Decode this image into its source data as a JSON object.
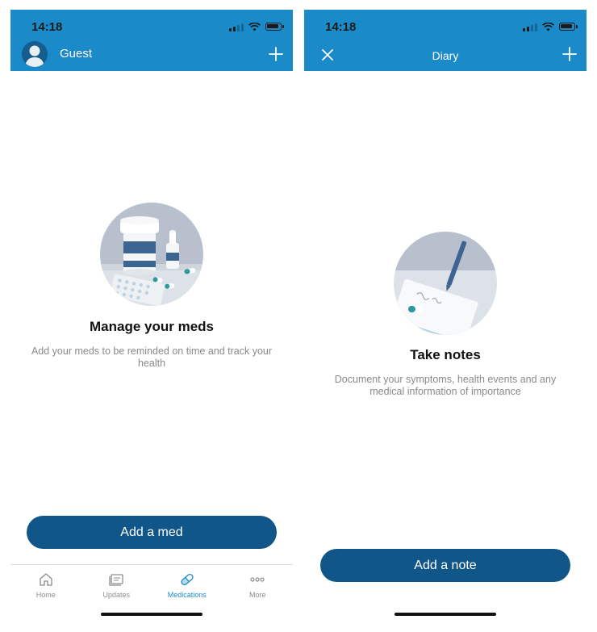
{
  "left_screen": {
    "status_time": "14:18",
    "header": {
      "user_name": "Guest"
    },
    "empty_state": {
      "title": "Manage your meds",
      "description": "Add your meds to be reminded on time and track your health"
    },
    "primary_button": "Add a med",
    "tabs": [
      {
        "label": "Home",
        "icon": "home-icon"
      },
      {
        "label": "Updates",
        "icon": "updates-icon"
      },
      {
        "label": "Medications",
        "icon": "pill-icon",
        "active": true
      },
      {
        "label": "More",
        "icon": "more-icon"
      }
    ]
  },
  "right_screen": {
    "status_time": "14:18",
    "header": {
      "title": "Diary"
    },
    "empty_state": {
      "title": "Take notes",
      "description": "Document your symptoms, health events and any medical information of importance"
    },
    "primary_button": "Add a note"
  },
  "colors": {
    "header_blue": "#1b8ac8",
    "button_blue": "#115688",
    "active_tab": "#1b8ac8",
    "muted_text": "#8a8a8a"
  }
}
